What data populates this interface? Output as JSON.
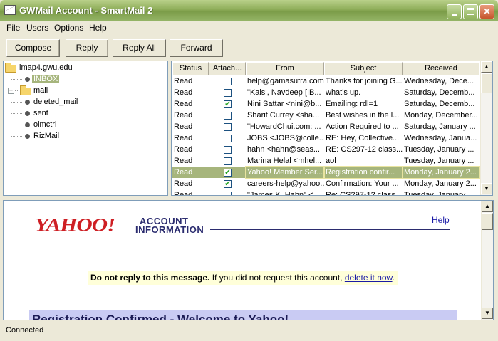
{
  "window": {
    "title": "GWMail Account - SmartMail 2"
  },
  "menu": [
    "File",
    "Users",
    "Options",
    "Help"
  ],
  "toolbar": {
    "compose": "Compose",
    "reply": "Reply",
    "reply_all": "Reply All",
    "forward": "Forward"
  },
  "folders": {
    "root": "imap4.gwu.edu",
    "items": [
      "INBOX",
      "mail",
      "deleted_mail",
      "sent",
      "oimctrl",
      "RizMail"
    ],
    "selected": "INBOX"
  },
  "columns": [
    "Status",
    "Attach...",
    "From",
    "Subject",
    "Received"
  ],
  "messages": [
    {
      "status": "Read",
      "attach": false,
      "from": "help@gamasutra.com",
      "subject": "Thanks for joining G...",
      "received": "Wednesday, Dece..."
    },
    {
      "status": "Read",
      "attach": false,
      "from": "\"Kalsi, Navdeep [IB...",
      "subject": "what's up.",
      "received": "Saturday, Decemb..."
    },
    {
      "status": "Read",
      "attach": true,
      "from": "Nini Sattar <nini@b...",
      "subject": "Emailing: rdl=1",
      "received": "Saturday, Decemb..."
    },
    {
      "status": "Read",
      "attach": false,
      "from": "Sharif Currey <sha...",
      "subject": "Best wishes in the l...",
      "received": "Monday, December..."
    },
    {
      "status": "Read",
      "attach": false,
      "from": "\"HowardChui.com: ...",
      "subject": "Action Required to ...",
      "received": "Saturday, January ..."
    },
    {
      "status": "Read",
      "attach": false,
      "from": "JOBS <JOBS@colle...",
      "subject": "RE: Hey, Collective...",
      "received": "Wednesday, Janua..."
    },
    {
      "status": "Read",
      "attach": false,
      "from": "hahn <hahn@seas...",
      "subject": "RE: CS297-12 class...",
      "received": "Tuesday, January ..."
    },
    {
      "status": "Read",
      "attach": false,
      "from": "Marina Helal <mhel...",
      "subject": "aol",
      "received": "Tuesday, January ..."
    },
    {
      "status": "Read",
      "attach": true,
      "from": "Yahoo! Member Ser...",
      "subject": "Registration confir...",
      "received": "Monday, January 2...",
      "selected": true
    },
    {
      "status": "Read",
      "attach": true,
      "from": "careers-help@yahoo...",
      "subject": "Confirmation: Your ...",
      "received": "Monday, January 2..."
    },
    {
      "status": "Read",
      "attach": false,
      "from": "\"James K. Hahn\" <...",
      "subject": "Re: CS297-12 class...",
      "received": "Tuesday, January ..."
    }
  ],
  "preview": {
    "logo": "YAHOO!",
    "account_line1": "ACCOUNT",
    "account_line2": "INFORMATION",
    "help": "Help",
    "notice_bold": "Do not reply to this message.",
    "notice_text": " If you did not request this account, ",
    "notice_link": "delete it now",
    "notice_end": ".",
    "banner": "Registration Confirmed - Welcome to Yahoo!"
  },
  "status": "Connected",
  "colors": {
    "titlebar": "#8fae5a",
    "selection": "#a6b57c",
    "yahoo_red": "#ce1f24",
    "link": "#1a1aa6"
  }
}
